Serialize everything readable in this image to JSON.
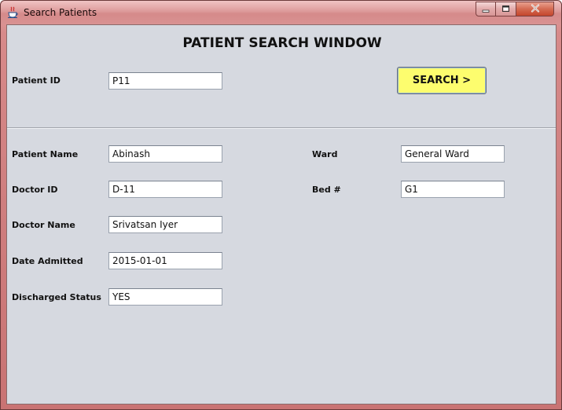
{
  "window": {
    "title": "Search Patients",
    "icons": {
      "app": "java-cup-icon",
      "minimize": "minimize-icon",
      "maximize": "maximize-icon",
      "close": "close-icon"
    }
  },
  "form": {
    "heading": "PATIENT SEARCH WINDOW",
    "patient_id": {
      "label": "Patient ID",
      "value": "P11"
    },
    "search_label": "SEARCH >",
    "patient_name": {
      "label": "Patient Name",
      "value": "Abinash"
    },
    "doctor_id": {
      "label": "Doctor ID",
      "value": "D-11"
    },
    "doctor_name": {
      "label": "Doctor Name",
      "value": "Srivatsan Iyer"
    },
    "date_admitted": {
      "label": "Date Admitted",
      "value": "2015-01-01"
    },
    "discharged_status": {
      "label": "Discharged Status",
      "value": "YES"
    },
    "ward": {
      "label": "Ward",
      "value": "General Ward"
    },
    "bed": {
      "label": "Bed #",
      "value": "G1"
    }
  },
  "colors": {
    "search_button": "#fdfd6e",
    "panel_background": "#d6d9e0",
    "title_bar": "#d58a8a"
  }
}
